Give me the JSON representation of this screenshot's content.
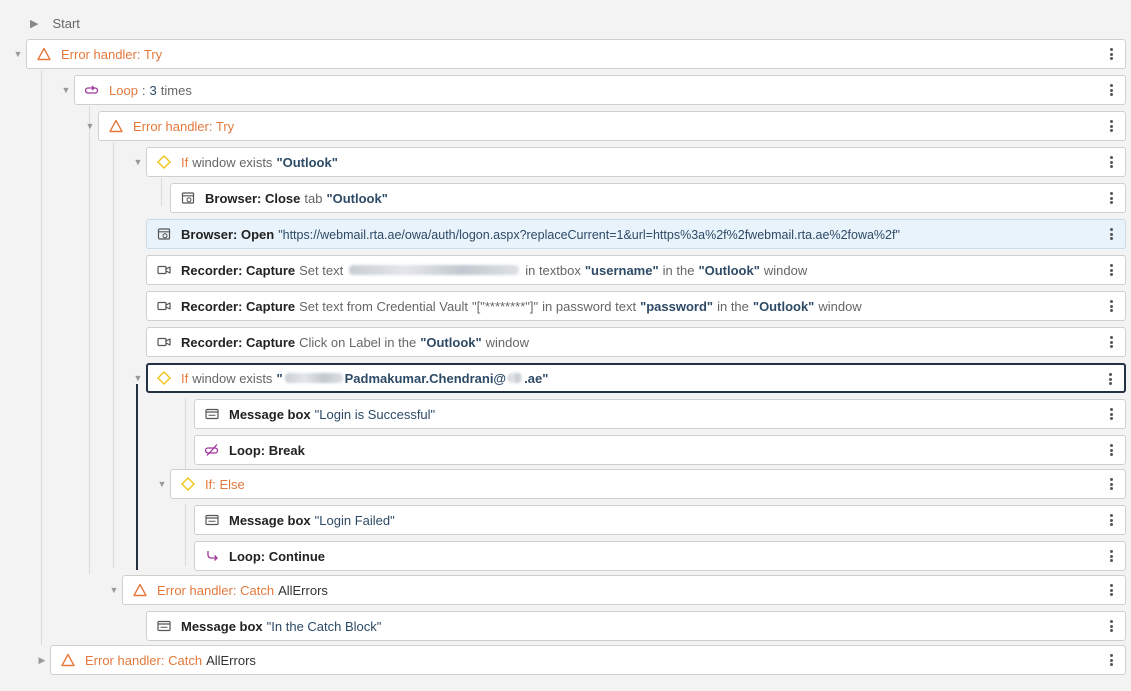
{
  "start_label": "Start",
  "rows": {
    "eh_try_outer": {
      "keyword": "Error handler: Try"
    },
    "loop": {
      "keyword": "Loop",
      "sep": ":",
      "count": "3",
      "suffix": "times"
    },
    "eh_try_inner": {
      "keyword": "Error handler: Try"
    },
    "if_outlook": {
      "keyword": "If",
      "text": "window exists",
      "value": "\"Outlook\""
    },
    "browser_close": {
      "keyword": "Browser: Close",
      "text": "tab",
      "value": "\"Outlook\""
    },
    "browser_open": {
      "keyword": "Browser: Open",
      "value": "\"https://webmail.rta.ae/owa/auth/logon.aspx?replaceCurrent=1&url=https%3a%2f%2fwebmail.rta.ae%2fowa%2f\""
    },
    "rec_username": {
      "keyword": "Recorder: Capture",
      "text1": "Set text",
      "text2": "in textbox",
      "field": "\"username\"",
      "text3": "in the",
      "window": "\"Outlook\"",
      "text4": "window"
    },
    "rec_password": {
      "keyword": "Recorder: Capture",
      "text1": "Set text from Credential Vault",
      "vault": "\"[\"********\"]\"",
      "text2": "in password text",
      "field": "\"password\"",
      "text3": "in the",
      "window": "\"Outlook\"",
      "text4": "window"
    },
    "rec_click": {
      "keyword": "Recorder: Capture",
      "text1": "Click on Label in the",
      "window": "\"Outlook\"",
      "text2": "window"
    },
    "if_user": {
      "keyword": "If",
      "text": "window exists",
      "quote_open": "\"",
      "name": "Padmakumar.Chendrani@",
      "domain_end": ".ae\""
    },
    "msg_success": {
      "keyword": "Message box",
      "value": "\"Login is Successful\""
    },
    "loop_break": {
      "keyword": "Loop: Break"
    },
    "if_else": {
      "keyword": "If: Else"
    },
    "msg_failed": {
      "keyword": "Message box",
      "value": "\"Login Failed\""
    },
    "loop_continue": {
      "keyword": "Loop: Continue"
    },
    "eh_catch_inner": {
      "keyword": "Error handler: Catch",
      "value": "AllErrors"
    },
    "msg_catch": {
      "keyword": "Message box",
      "value": "\"In the Catch Block\""
    },
    "eh_catch_outer": {
      "keyword": "Error handler: Catch",
      "value": "AllErrors"
    }
  },
  "icons": {
    "error_handler": "triangle-warning-icon",
    "loop": "loop-icon",
    "if": "diamond-icon",
    "browser": "browser-icon",
    "recorder": "video-camera-icon",
    "message_box": "message-box-icon",
    "loop_break": "loop-break-icon",
    "loop_continue": "loop-continue-icon",
    "more": "more-vertical-icon"
  },
  "colors": {
    "error_handler": "#e3793d",
    "loop": "#a0359c",
    "if": "#f0c419",
    "highlight_bg": "#e9f3fb",
    "selected_border": "#233142"
  }
}
